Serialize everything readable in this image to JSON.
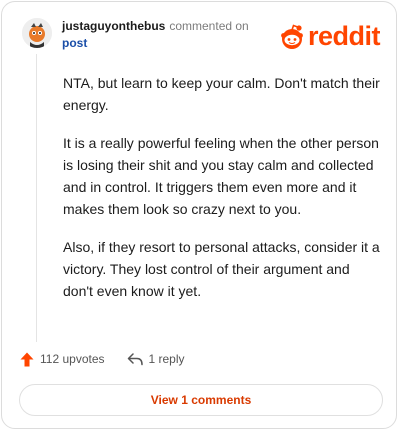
{
  "comment": {
    "username": "justaguyonthebus",
    "action_text": "commented on",
    "target_link": "post",
    "paragraphs": [
      "NTA, but learn to keep your calm. Don't match their energy.",
      "It is a really powerful feeling when the other person is losing their shit and you stay calm and collected and in control. It triggers them even more and it makes them look so crazy next to you.",
      "Also, if they resort to personal attacks, consider it a victory. They lost control of their argument and don't even know it yet."
    ]
  },
  "brand": {
    "logo_text": "reddit",
    "color": "#ff4500"
  },
  "actions": {
    "upvotes": "112 upvotes",
    "replies": "1 reply"
  },
  "footer": {
    "view_comments_label": "View 1 comments",
    "accent": "#d93a00"
  },
  "icons": {
    "upvote": "upvote-arrow-icon",
    "reply": "reply-arrow-icon",
    "logo": "reddit-alien-icon"
  }
}
